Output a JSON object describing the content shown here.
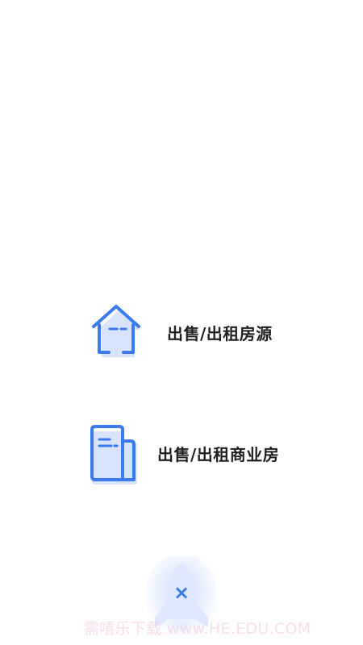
{
  "options": [
    {
      "label": "出售/出租房源",
      "icon": "house-icon"
    },
    {
      "label": "出售/出租商业房",
      "icon": "building-document-icon"
    }
  ],
  "close": {
    "icon": "close-icon",
    "symbol": "×"
  },
  "watermark": {
    "text": "需嘻乐下载 www.HE.EDU.COM"
  },
  "colors": {
    "icon_blue": "#3a7bf0",
    "icon_shadow": "#d7e4fb",
    "label_text": "#1f1f1f",
    "rocket_glow": "#c9d9ff",
    "rocket_body": "#dfe8ff"
  }
}
